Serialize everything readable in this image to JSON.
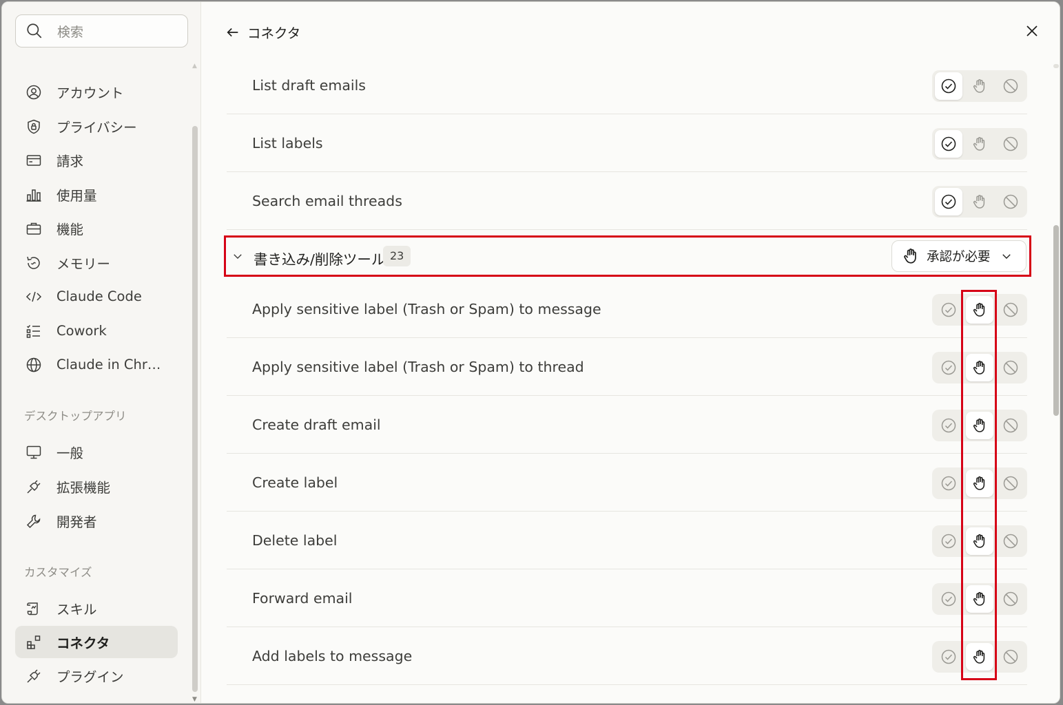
{
  "search": {
    "placeholder": "検索"
  },
  "sidebar": {
    "items": [
      {
        "label": "アカウント",
        "icon": "user-circle-icon"
      },
      {
        "label": "プライバシー",
        "icon": "shield-lock-icon"
      },
      {
        "label": "請求",
        "icon": "credit-card-icon"
      },
      {
        "label": "使用量",
        "icon": "bar-chart-icon"
      },
      {
        "label": "機能",
        "icon": "briefcase-icon"
      },
      {
        "label": "メモリー",
        "icon": "history-icon"
      },
      {
        "label": "Claude Code",
        "icon": "code-icon"
      },
      {
        "label": "Cowork",
        "icon": "checklist-icon"
      },
      {
        "label": "Claude in Chr…",
        "icon": "globe-icon"
      }
    ],
    "desktop_section": "デスクトップアプリ",
    "desktop_items": [
      {
        "label": "一般",
        "icon": "monitor-icon"
      },
      {
        "label": "拡張機能",
        "icon": "plug-icon"
      },
      {
        "label": "開発者",
        "icon": "wrench-icon"
      }
    ],
    "customize_section": "カスタマイズ",
    "customize_items": [
      {
        "label": "スキル",
        "icon": "scroll-icon"
      },
      {
        "label": "コネクタ",
        "icon": "connector-icon",
        "active": true
      },
      {
        "label": "プラグイン",
        "icon": "plug-icon"
      }
    ]
  },
  "header": {
    "title": "コネクタ"
  },
  "read_tools": [
    {
      "name": "List draft emails",
      "state": "allow"
    },
    {
      "name": "List labels",
      "state": "allow"
    },
    {
      "name": "Search email threads",
      "state": "allow"
    }
  ],
  "write_group": {
    "label": "書き込み/削除ツール",
    "count": "23",
    "policy": "承認が必要"
  },
  "write_tools": [
    {
      "name": "Apply sensitive label (Trash or Spam) to message",
      "state": "ask"
    },
    {
      "name": "Apply sensitive label (Trash or Spam) to thread",
      "state": "ask"
    },
    {
      "name": "Create draft email",
      "state": "ask"
    },
    {
      "name": "Create label",
      "state": "ask"
    },
    {
      "name": "Delete label",
      "state": "ask"
    },
    {
      "name": "Forward email",
      "state": "ask"
    },
    {
      "name": "Add labels to message",
      "state": "ask"
    }
  ],
  "colors": {
    "highlight": "#d60016",
    "active_nav_bg": "#e6e5e0"
  }
}
